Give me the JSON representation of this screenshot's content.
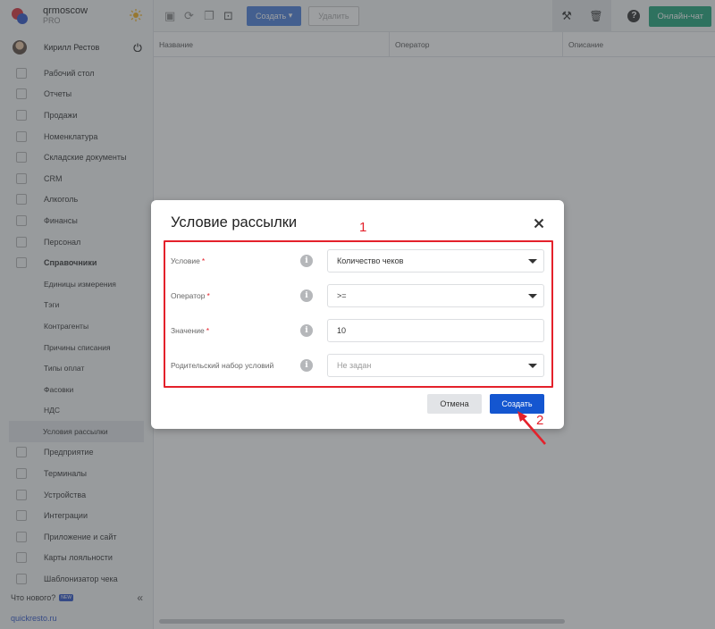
{
  "org": {
    "name": "qrmoscow",
    "plan": "PRO"
  },
  "user": {
    "name": "Кирилл Рестов"
  },
  "sidebar": {
    "items": [
      {
        "label": "Рабочий стол",
        "type": "top"
      },
      {
        "label": "Отчеты",
        "type": "top"
      },
      {
        "label": "Продажи",
        "type": "top"
      },
      {
        "label": "Номенклатура",
        "type": "top"
      },
      {
        "label": "Складские документы",
        "type": "top"
      },
      {
        "label": "CRM",
        "type": "top"
      },
      {
        "label": "Алкоголь",
        "type": "top"
      },
      {
        "label": "Финансы",
        "type": "top"
      },
      {
        "label": "Персонал",
        "type": "top"
      },
      {
        "label": "Справочники",
        "type": "top-bold"
      },
      {
        "label": "Единицы измерения",
        "type": "sub"
      },
      {
        "label": "Тэги",
        "type": "sub"
      },
      {
        "label": "Контрагенты",
        "type": "sub"
      },
      {
        "label": "Причины списания",
        "type": "sub"
      },
      {
        "label": "Типы оплат",
        "type": "sub"
      },
      {
        "label": "Фасовки",
        "type": "sub"
      },
      {
        "label": "НДС",
        "type": "sub"
      },
      {
        "label": "Условия рассылки",
        "type": "sub-active"
      },
      {
        "label": "Предприятие",
        "type": "top"
      },
      {
        "label": "Терминалы",
        "type": "top"
      },
      {
        "label": "Устройства",
        "type": "top"
      },
      {
        "label": "Интеграции",
        "type": "top"
      },
      {
        "label": "Приложение и сайт",
        "type": "top"
      },
      {
        "label": "Карты лояльности",
        "type": "top"
      },
      {
        "label": "Шаблонизатор чека",
        "type": "top"
      }
    ],
    "news_label": "Что нового?",
    "news_badge": "NEW",
    "collapse_glyph": "«",
    "site_link": "quickresto.ru"
  },
  "toolbar": {
    "create_label": "Создать",
    "delete_label": "Удалить",
    "chat_label": "Онлайн-чат",
    "help_glyph": "?"
  },
  "table": {
    "columns": [
      "Название",
      "Оператор",
      "Описание"
    ]
  },
  "dialog": {
    "title": "Условие рассылки",
    "fields": [
      {
        "label": "Условие",
        "required": "*",
        "value": "Количество чеков",
        "kind": "select"
      },
      {
        "label": "Оператор",
        "required": "*",
        "value": ">=",
        "kind": "select"
      },
      {
        "label": "Значение",
        "required": "*",
        "value": "10",
        "kind": "input"
      },
      {
        "label": "Родительский набор условий",
        "required": "",
        "value": "Не задан",
        "kind": "select-placeholder"
      }
    ],
    "info_glyph": "i",
    "cancel_label": "Отмена",
    "create_label": "Создать"
  },
  "annotations": {
    "box_number": "1",
    "arrow_number": "2"
  },
  "colors": {
    "accent": "#1456d0",
    "chat": "#21a57a",
    "annotation": "#e4212b"
  }
}
